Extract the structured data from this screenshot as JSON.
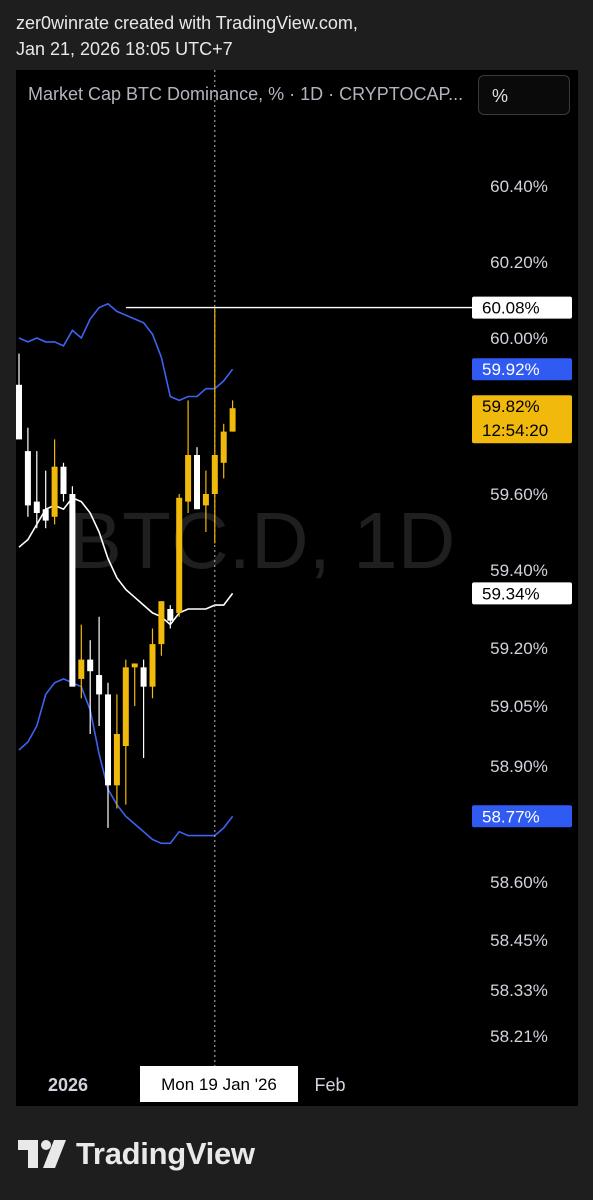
{
  "header": {
    "line1": "zer0winrate created with TradingView.com,",
    "line2": "Jan 21, 2026 18:05 UTC+7"
  },
  "chart_header": {
    "title": "Market Cap BTC Dominance, % · 1D · CRYPTOCAP...",
    "scale_button": "%"
  },
  "watermark": "BTC.D, 1D",
  "footer": {
    "brand": "TradingView"
  },
  "colors": {
    "background": "#000000",
    "bullish": "#f0b90b",
    "bearish": "#ffffff",
    "band": "#3d63f0",
    "ma": "#ffffff",
    "price_badge": "#f0b90b",
    "band_badge": "#2f5bf3"
  },
  "chart_data": {
    "type": "candlestick",
    "symbol": "BTC.D",
    "interval": "1D",
    "y_axis": {
      "ticks": [
        {
          "label": "60.40%",
          "value": 60.4
        },
        {
          "label": "60.20%",
          "value": 60.2
        },
        {
          "label": "60.00%",
          "value": 60.0
        },
        {
          "label": "59.60%",
          "value": 59.6
        },
        {
          "label": "59.40%",
          "value": 59.4
        },
        {
          "label": "59.20%",
          "value": 59.2
        },
        {
          "label": "59.05%",
          "value": 59.05
        },
        {
          "label": "58.90%",
          "value": 58.9
        },
        {
          "label": "58.60%",
          "value": 58.6
        },
        {
          "label": "58.45%",
          "value": 58.45
        },
        {
          "label": "58.33%",
          "value": 58.33
        },
        {
          "label": "58.21%",
          "value": 58.21
        }
      ]
    },
    "x_axis": {
      "labels": [
        "2026",
        "Feb"
      ],
      "crosshair_label": "Mon 19 Jan '26"
    },
    "badges": {
      "high_line": {
        "label": "60.08%",
        "value": 60.08
      },
      "upper_band": {
        "label": "59.92%",
        "value": 59.92
      },
      "last_price": {
        "label": "59.82%",
        "value": 59.82,
        "countdown": "12:54:20"
      },
      "basis": {
        "label": "59.34%",
        "value": 59.34
      },
      "lower_band": {
        "label": "58.77%",
        "value": 58.77
      }
    },
    "candles": [
      {
        "o": 59.88,
        "h": 59.96,
        "l": 59.76,
        "c": 59.74
      },
      {
        "o": 59.71,
        "h": 59.77,
        "l": 59.54,
        "c": 59.57
      },
      {
        "o": 59.58,
        "h": 59.71,
        "l": 59.51,
        "c": 59.55
      },
      {
        "o": 59.56,
        "h": 59.66,
        "l": 59.51,
        "c": 59.53
      },
      {
        "o": 59.54,
        "h": 59.74,
        "l": 59.52,
        "c": 59.67
      },
      {
        "o": 59.67,
        "h": 59.68,
        "l": 59.58,
        "c": 59.6
      },
      {
        "o": 59.6,
        "h": 59.62,
        "l": 59.15,
        "c": 59.1
      },
      {
        "o": 59.12,
        "h": 59.26,
        "l": 59.07,
        "c": 59.17
      },
      {
        "o": 59.17,
        "h": 59.22,
        "l": 58.98,
        "c": 59.14
      },
      {
        "o": 59.13,
        "h": 59.28,
        "l": 59.0,
        "c": 59.08
      },
      {
        "o": 59.08,
        "h": 59.11,
        "l": 58.74,
        "c": 58.85
      },
      {
        "o": 58.85,
        "h": 59.08,
        "l": 58.79,
        "c": 58.98
      },
      {
        "o": 58.95,
        "h": 59.17,
        "l": 58.8,
        "c": 59.15
      },
      {
        "o": 59.15,
        "h": 59.16,
        "l": 59.05,
        "c": 59.16
      },
      {
        "o": 59.15,
        "h": 59.17,
        "l": 58.92,
        "c": 59.1
      },
      {
        "o": 59.1,
        "h": 59.25,
        "l": 59.07,
        "c": 59.21
      },
      {
        "o": 59.21,
        "h": 59.32,
        "l": 59.18,
        "c": 59.32
      },
      {
        "o": 59.3,
        "h": 59.31,
        "l": 59.25,
        "c": 59.27
      },
      {
        "o": 59.29,
        "h": 59.6,
        "l": 59.28,
        "c": 59.59
      },
      {
        "o": 59.58,
        "h": 59.84,
        "l": 59.55,
        "c": 59.7
      },
      {
        "o": 59.7,
        "h": 59.72,
        "l": 59.56,
        "c": 59.56
      },
      {
        "o": 59.57,
        "h": 59.66,
        "l": 59.5,
        "c": 59.6
      },
      {
        "o": 59.6,
        "h": 60.08,
        "l": 59.47,
        "c": 59.7
      },
      {
        "o": 59.68,
        "h": 59.78,
        "l": 59.64,
        "c": 59.76
      },
      {
        "o": 59.76,
        "h": 59.84,
        "l": 59.76,
        "c": 59.82
      }
    ],
    "upper_band": [
      60.0,
      59.99,
      60.0,
      59.99,
      59.99,
      59.98,
      60.02,
      60.0,
      60.05,
      60.08,
      60.09,
      60.07,
      60.06,
      60.05,
      60.04,
      60.01,
      59.95,
      59.85,
      59.84,
      59.85,
      59.85,
      59.87,
      59.87,
      59.89,
      59.92
    ],
    "basis": [
      59.46,
      59.48,
      59.52,
      59.56,
      59.57,
      59.56,
      59.59,
      59.58,
      59.55,
      59.5,
      59.43,
      59.38,
      59.35,
      59.33,
      59.31,
      59.29,
      59.28,
      59.26,
      59.29,
      59.3,
      59.3,
      59.3,
      59.31,
      59.31,
      59.34
    ],
    "lower_band": [
      58.94,
      58.96,
      59.0,
      59.08,
      59.11,
      59.12,
      59.11,
      59.1,
      59.04,
      58.93,
      58.84,
      58.8,
      58.77,
      58.75,
      58.73,
      58.71,
      58.7,
      58.7,
      58.73,
      58.72,
      58.72,
      58.72,
      58.72,
      58.74,
      58.77
    ]
  }
}
